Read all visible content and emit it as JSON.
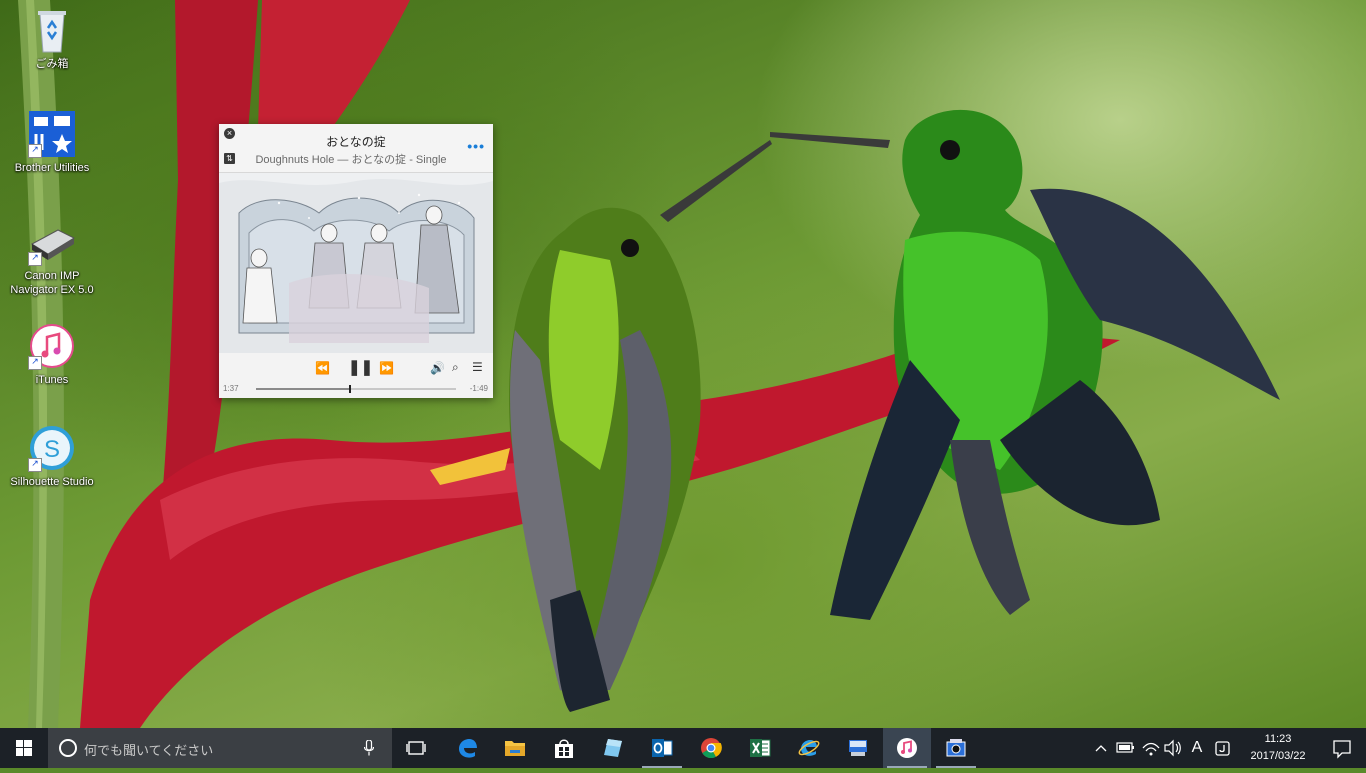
{
  "desktop": {
    "icons": [
      {
        "label": "ごみ箱",
        "icon": "recycle-bin-icon"
      },
      {
        "label": "Brother Utilities",
        "icon": "brother-utilities-icon"
      },
      {
        "label": "Canon IMP Navigator EX 5.0",
        "icon": "canon-scanner-icon"
      },
      {
        "label": "iTunes",
        "icon": "itunes-icon"
      },
      {
        "label": "Silhouette Studio",
        "icon": "silhouette-studio-icon"
      }
    ]
  },
  "mini_player": {
    "track_title": "おとなの掟",
    "track_subtitle": "Doughnuts Hole — おとなの掟 - Single",
    "more_label": "•••",
    "close_glyph": "×",
    "expand_glyph": "⇅",
    "time_elapsed": "1:37",
    "time_remaining": "-1:49",
    "progress_fraction": 0.47,
    "controls": {
      "rewind": "⏪",
      "pause": "❚❚",
      "forward": "⏩",
      "volume": "🔊",
      "search": "⌕",
      "list": "☰"
    }
  },
  "taskbar": {
    "search_placeholder": "何でも聞いてください",
    "pinned_apps": [
      {
        "name": "task-view",
        "icon": "task-view-icon"
      },
      {
        "name": "edge",
        "icon": "edge-icon"
      },
      {
        "name": "file-explorer",
        "icon": "folder-icon"
      },
      {
        "name": "store",
        "icon": "store-icon"
      },
      {
        "name": "app-blue",
        "icon": "glass-pane-icon"
      },
      {
        "name": "outlook",
        "icon": "outlook-icon"
      },
      {
        "name": "chrome",
        "icon": "chrome-icon"
      },
      {
        "name": "excel",
        "icon": "excel-icon"
      },
      {
        "name": "internet-explorer",
        "icon": "ie-icon"
      },
      {
        "name": "brother",
        "icon": "brother-app-icon"
      },
      {
        "name": "itunes",
        "icon": "itunes-icon"
      },
      {
        "name": "scanner",
        "icon": "scanner-app-icon"
      }
    ],
    "tray": {
      "ime_label": "A",
      "time": "11:23",
      "date": "2017/03/22"
    }
  },
  "colors": {
    "taskbar_bg": "#1c2127",
    "accent_blue": "#1a7ed8",
    "excel_green": "#1e7145",
    "outlook_blue": "#0a64ad"
  }
}
